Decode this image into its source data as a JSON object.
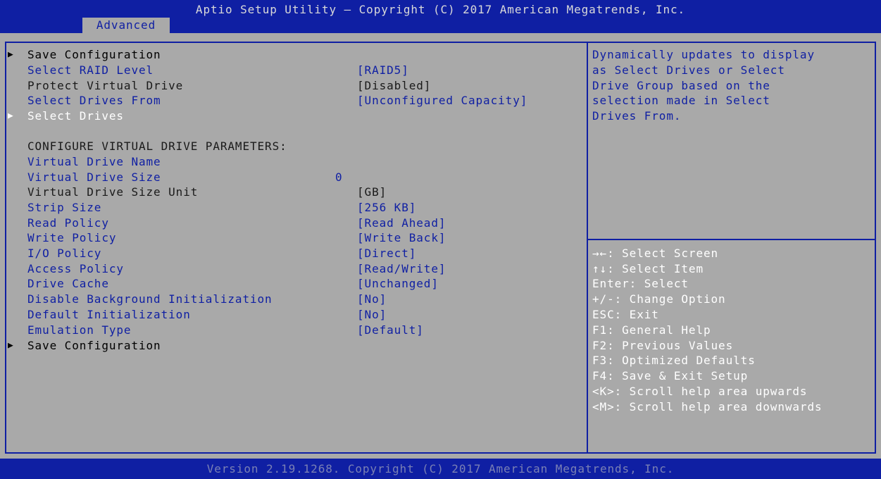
{
  "header": {
    "title": "Aptio Setup Utility – Copyright (C) 2017 American Megatrends, Inc.",
    "active_tab": "Advanced"
  },
  "settings": {
    "save_configuration_top": "Save Configuration",
    "select_raid_level": {
      "label": "Select RAID Level",
      "value": "[RAID5]"
    },
    "protect_virtual_drive": {
      "label": "Protect Virtual Drive",
      "value": "[Disabled]"
    },
    "select_drives_from": {
      "label": "Select Drives From",
      "value": "[Unconfigured Capacity]"
    },
    "select_drives": "Select Drives",
    "section_heading": "CONFIGURE VIRTUAL DRIVE PARAMETERS:",
    "virtual_drive_name": {
      "label": "Virtual Drive Name"
    },
    "virtual_drive_size": {
      "label": "Virtual Drive Size",
      "value": "0"
    },
    "virtual_drive_size_unit": {
      "label": "Virtual Drive Size Unit",
      "value": "[GB]"
    },
    "strip_size": {
      "label": "Strip Size",
      "value": "[256 KB]"
    },
    "read_policy": {
      "label": "Read Policy",
      "value": "[Read Ahead]"
    },
    "write_policy": {
      "label": "Write Policy",
      "value": "[Write Back]"
    },
    "io_policy": {
      "label": "I/O Policy",
      "value": "[Direct]"
    },
    "access_policy": {
      "label": "Access Policy",
      "value": "[Read/Write]"
    },
    "drive_cache": {
      "label": "Drive Cache",
      "value": "[Unchanged]"
    },
    "disable_background_init": {
      "label": "Disable Background Initialization",
      "value": "[No]"
    },
    "default_initialization": {
      "label": "Default Initialization",
      "value": "[No]"
    },
    "emulation_type": {
      "label": "Emulation Type",
      "value": "[Default]"
    },
    "save_configuration_bottom": "Save Configuration"
  },
  "help": {
    "lines": [
      "Dynamically updates to display",
      "as Select Drives or Select",
      "Drive Group based on the",
      "selection made in Select",
      "Drives From."
    ]
  },
  "keys": [
    "→←: Select Screen",
    "↑↓: Select Item",
    "Enter: Select",
    "+/-: Change Option",
    "ESC: Exit",
    "F1: General Help",
    "F2: Previous Values",
    "F3: Optimized Defaults",
    "F4: Save & Exit Setup",
    "<K>: Scroll help area upwards",
    "<M>: Scroll help area downwards"
  ],
  "footer": {
    "version": "Version 2.19.1268. Copyright (C) 2017 American Megatrends, Inc."
  },
  "colors": {
    "primary_blue": "#0f1fa3",
    "panel_gray": "#a9a9a9",
    "highlight_white": "#ffffff"
  },
  "icons": {
    "submenu_arrow": "triangle-right-icon"
  }
}
